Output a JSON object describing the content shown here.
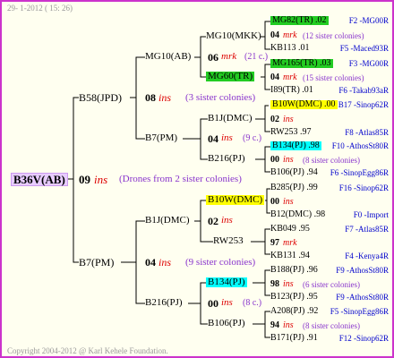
{
  "header": {
    "date": "29-  1-2012 ( 15: 26)"
  },
  "footer": {
    "copyright": "Copyright 2004-2012 @ Karl Kehele Foundation."
  },
  "root": {
    "name": "B36V(AB)",
    "gen": "09",
    "ins": "ins",
    "note": "(Drones from 2 sister colonies)"
  },
  "sire": {
    "name": "B58(JPD)",
    "gen": "08",
    "ins": "ins",
    "note": "(3 sister colonies)",
    "sire": {
      "name": "MG10(AB)",
      "gen": "06",
      "ins": "mrk",
      "note": "(21 c.)",
      "sire": {
        "name": "MG10(MKK)"
      },
      "dam": {
        "name": "MG60(TR)"
      }
    },
    "dam": {
      "name": "B7(PM)",
      "gen": "04",
      "ins": "ins",
      "note": "(9 c.)",
      "sire": {
        "name": "B1J(DMC)"
      },
      "dam": {
        "name": "B216(PJ)"
      }
    }
  },
  "dam": {
    "name": "B7(PM)",
    "gen": "04",
    "ins": "ins",
    "note": "(9 sister colonies)",
    "sire": {
      "name": "B1J(DMC)",
      "gen": "02",
      "ins": "ins",
      "sire": {
        "name": "B10W(DMC)"
      },
      "dam": {
        "name": "RW253"
      }
    },
    "dam": {
      "name": "B216(PJ)",
      "gen": "00",
      "ins": "ins",
      "note": "(8 c.)",
      "sire": {
        "name": "B134(PJ)"
      },
      "dam": {
        "name": "B106(PJ)"
      }
    }
  },
  "rows": [
    {
      "line": "MG82(TR) .02",
      "right": "F2 -MG00R"
    },
    {
      "line": "04 ",
      "ins": "mrk",
      "note": "(12 sister colonies)"
    },
    {
      "line": "KB113 .01",
      "right": "F5 -Maced93R"
    },
    {
      "line": "MG165(TR) .03",
      "right": "F3 -MG00R"
    },
    {
      "line": "04 ",
      "ins": "mrk",
      "note": "(15 sister colonies)"
    },
    {
      "line": "I89(TR) .01",
      "right": "F6 -Takab93aR"
    },
    {
      "line": "B10W(DMC) .00",
      "right": "B17 -Sinop62R"
    },
    {
      "line": "02 ",
      "ins": "ins"
    },
    {
      "line": "RW253 .97",
      "right": "F8 -Atlas85R"
    },
    {
      "line": "B134(PJ) .98",
      "right": "F10 -AthosSt80R"
    },
    {
      "line": "00 ",
      "ins": "ins",
      "note": "(8 sister colonies)"
    },
    {
      "line": "B106(PJ) .94",
      "right": "F6 -SinopEgg86R"
    },
    {
      "line": "B285(PJ) .99",
      "right": "F16 -Sinop62R"
    },
    {
      "line": "00 ",
      "ins": "ins"
    },
    {
      "line": "B12(DMC) .98",
      "right": "F0 -Import"
    },
    {
      "line": "KB049 .95",
      "right": "F7 -Atlas85R"
    },
    {
      "line": "97 ",
      "ins": "mrk"
    },
    {
      "line": "KB131 .94",
      "right": "F4 -Kenya4R"
    },
    {
      "line": "B188(PJ) .96",
      "right": "F9 -AthosSt80R"
    },
    {
      "line": "98 ",
      "ins": "ins",
      "note": "(6 sister colonies)"
    },
    {
      "line": "B123(PJ) .95",
      "right": "F9 -AthosSt80R"
    },
    {
      "line": "A208(PJ) .92",
      "right": "F5 -SinopEgg86R"
    },
    {
      "line": "94 ",
      "ins": "ins",
      "note": "(8 sister colonies)"
    },
    {
      "line": "B171(PJ) .91",
      "right": "F12 -Sinop62R"
    }
  ],
  "colors": {
    "border": "#cc33cc",
    "green": "#22cc22",
    "yellow": "#ffff00",
    "cyan": "#00ffff",
    "ins": "#dd0000",
    "note": "#8833cc",
    "link": "#0000cc"
  }
}
